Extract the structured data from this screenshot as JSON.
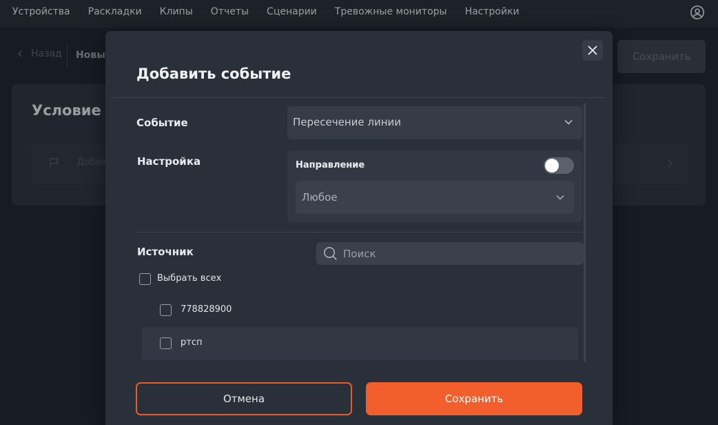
{
  "colors": {
    "accent": "#f35e2d",
    "background": "#1b212b",
    "modal": "#2a303a"
  },
  "nav": {
    "items": [
      {
        "label": "Устройства"
      },
      {
        "label": "Раскладки"
      },
      {
        "label": "Клипы"
      },
      {
        "label": "Отчеты"
      },
      {
        "label": "Сценарии"
      },
      {
        "label": "Тревожные мониторы"
      },
      {
        "label": "Настройки"
      }
    ],
    "profile_icon": "user-circle-icon"
  },
  "page": {
    "back_label": "Назад",
    "title_partial": "Новый",
    "save_label": "Сохранить",
    "condition_title": "Условие",
    "condition_row_text": "Добав"
  },
  "modal": {
    "title": "Добавить событие",
    "event_label": "Событие",
    "event_value": "Пересечение линии",
    "setting_label": "Настройка",
    "direction_label": "Направление",
    "direction_toggle_on": false,
    "direction_value": "Любое",
    "source_label": "Источник",
    "search_placeholder": "Поиск",
    "select_all_label": "Выбрать всех",
    "sources": [
      {
        "label": "778828900",
        "checked": false
      },
      {
        "label": "ртсп",
        "checked": false
      }
    ],
    "cancel_label": "Отмена",
    "save_label": "Сохранить"
  }
}
